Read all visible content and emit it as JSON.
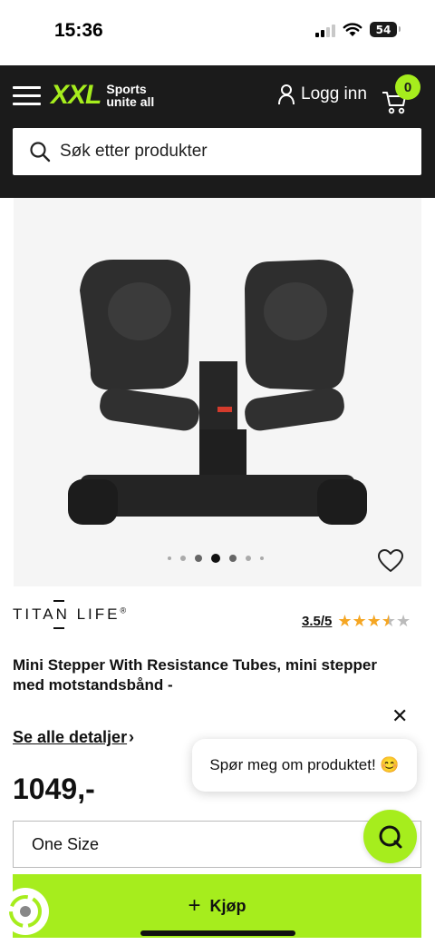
{
  "status_bar": {
    "time": "15:36",
    "battery": "54"
  },
  "header": {
    "logo": "XXL",
    "tagline_line1": "Sports",
    "tagline_line2": "unite all",
    "login_label": "Logg inn",
    "cart_count": "0",
    "search_placeholder": "Søk etter produkter"
  },
  "gallery": {
    "image_count": 7,
    "active_index": 3
  },
  "product": {
    "brand": "TITAN LIFE",
    "brand_mark": "®",
    "rating_text": "3.5/5",
    "rating_value": 3.5,
    "rating_max": 5,
    "title": "Mini Stepper With Resistance Tubes, mini stepper med motstandsbånd -",
    "details_link": "Se alle detaljer",
    "price": "1049,-",
    "size": "One Size",
    "buy_label": "Kjøp"
  },
  "chat": {
    "bubble_text": "Spør meg om produktet! 😊"
  },
  "colors": {
    "accent": "#a6ed1d",
    "header_bg": "#1b1b1b",
    "star": "#f5a623"
  }
}
